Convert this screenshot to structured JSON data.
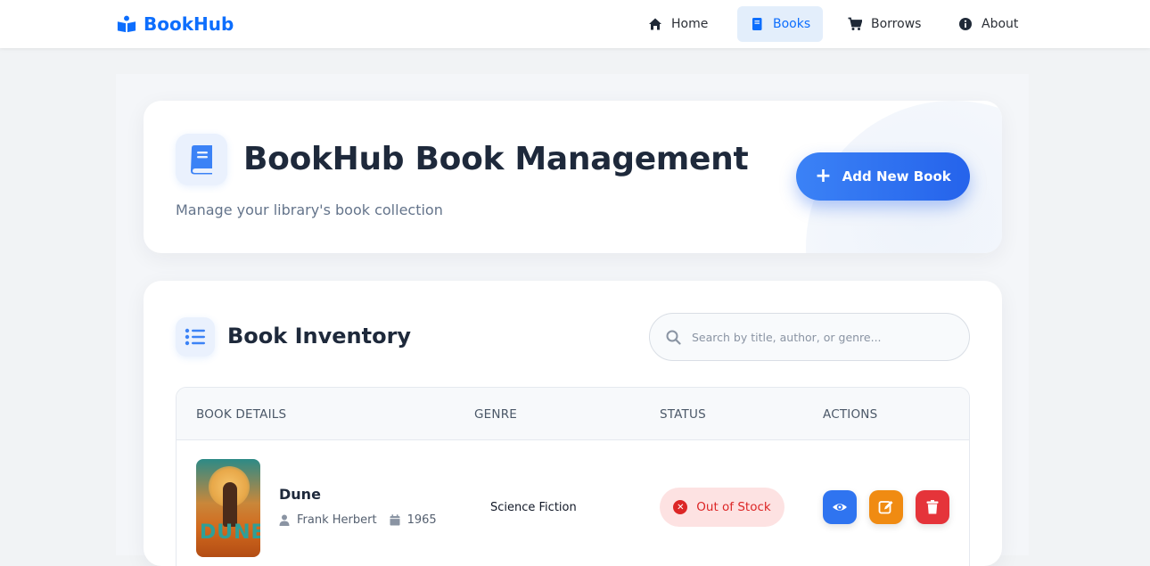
{
  "nav": {
    "brand": "BookHub",
    "items": [
      {
        "label": "Home",
        "icon": "home-icon"
      },
      {
        "label": "Books",
        "icon": "book-icon",
        "active": true
      },
      {
        "label": "Borrows",
        "icon": "cart-icon"
      },
      {
        "label": "About",
        "icon": "info-icon"
      }
    ]
  },
  "hero": {
    "title": "BookHub Book Management",
    "subtitle": "Manage your library's book collection",
    "add_button": "Add New Book"
  },
  "inventory": {
    "title": "Book Inventory",
    "search_placeholder": "Search by title, author, or genre...",
    "columns": [
      "BOOK DETAILS",
      "GENRE",
      "STATUS",
      "ACTIONS"
    ],
    "rows": [
      {
        "title": "Dune",
        "author": "Frank Herbert",
        "year": "1965",
        "cover_text": "DUNE",
        "genre": "Science Fiction",
        "status": "Out of Stock"
      }
    ]
  },
  "colors": {
    "primary": "#0d6efd",
    "add_button": "#2563eb",
    "status_out": "#dc2626",
    "status_out_bg": "#fde2e2",
    "view": "#2f74f0",
    "edit": "#f08b12",
    "delete": "#e5343a"
  }
}
